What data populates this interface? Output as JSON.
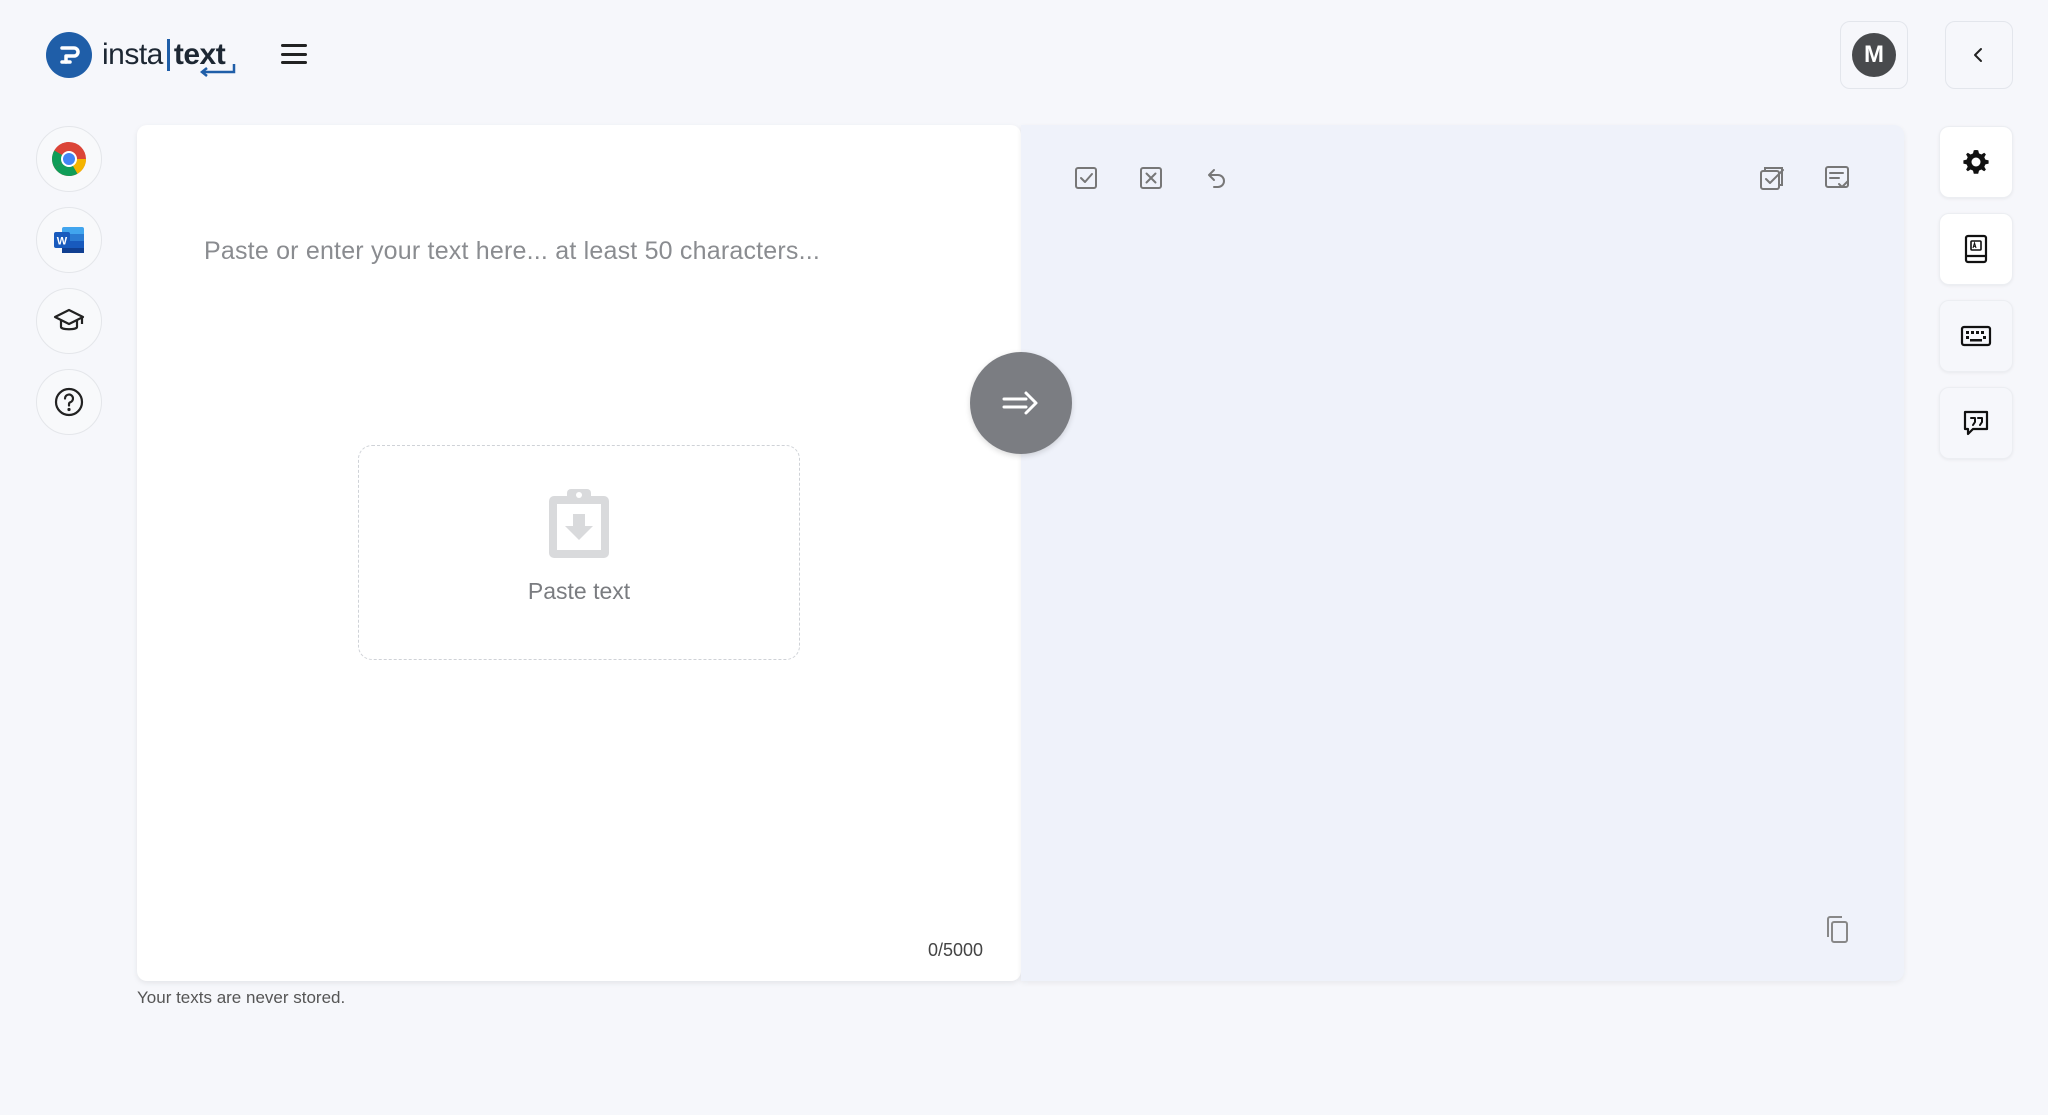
{
  "header": {
    "logo_left": "insta",
    "logo_right": "text",
    "avatar_initial": "M"
  },
  "left_rail": {
    "items": [
      {
        "icon": "chrome-icon"
      },
      {
        "icon": "word-icon"
      },
      {
        "icon": "graduation-cap-icon"
      },
      {
        "icon": "help-icon"
      }
    ]
  },
  "input": {
    "placeholder": "Paste or enter your text here... at least 50 characters...",
    "paste_label": "Paste text",
    "counter": "0/5000"
  },
  "output": {
    "toolbar_left": [
      "accept-all-icon",
      "reject-all-icon",
      "undo-icon"
    ],
    "toolbar_right": [
      "check-document-icon",
      "notes-check-icon"
    ],
    "copy_icon": "copy-icon"
  },
  "footer": {
    "storage_note": "Your texts are never stored."
  },
  "right_rail": {
    "items": [
      "gear-icon",
      "dictionary-icon",
      "keyboard-icon",
      "feedback-icon"
    ]
  },
  "colors": {
    "brand": "#1f5ea8",
    "background": "#f6f7fb",
    "output_bg": "#eff2fa",
    "action_button": "#7b7d82"
  }
}
